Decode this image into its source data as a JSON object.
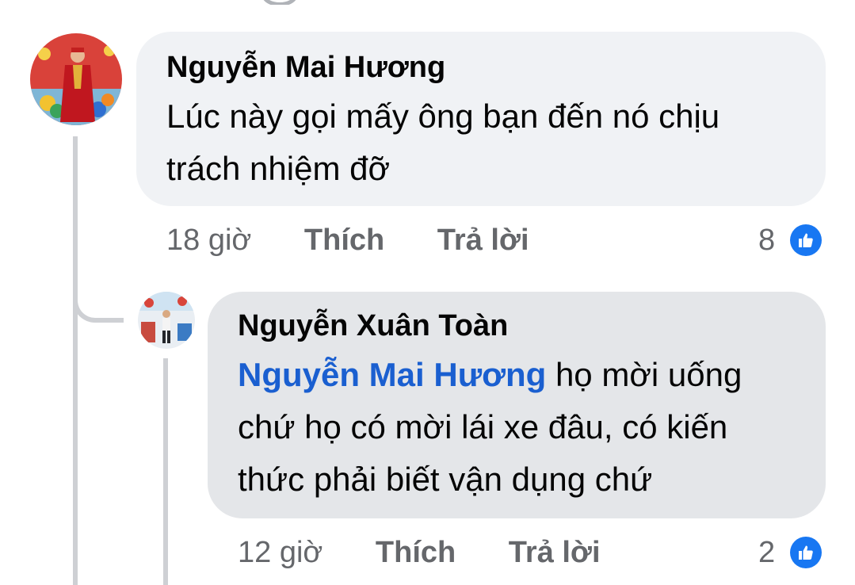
{
  "comments": [
    {
      "author": "Nguyễn Mai Hương",
      "text_line1": "Lúc này gọi mấy ông bạn đến nó chịu",
      "text_line2": "trách nhiệm đỡ",
      "time": "18 giờ",
      "like_label": "Thích",
      "reply_label": "Trả lời",
      "reaction_count": "8",
      "reaction_icon": "like-icon",
      "bubble_color": "#f0f2f5"
    },
    {
      "author": "Nguyễn Xuân Toàn",
      "mention": "Nguyễn Mai Hương",
      "text_line1": "họ mời uống",
      "text_line2": "chứ họ có mời lái xe đâu, có kiến",
      "text_line3": "thức phải biết vận dụng chứ",
      "time": "12 giờ",
      "like_label": "Thích",
      "reply_label": "Trả lời",
      "reaction_count": "2",
      "reaction_icon": "like-icon",
      "bubble_color": "#e4e6e9"
    }
  ],
  "colors": {
    "mention": "#1a5fd0",
    "like_blue": "#1877f2",
    "meta_gray": "#65676b",
    "thread_line": "#ced0d4"
  }
}
